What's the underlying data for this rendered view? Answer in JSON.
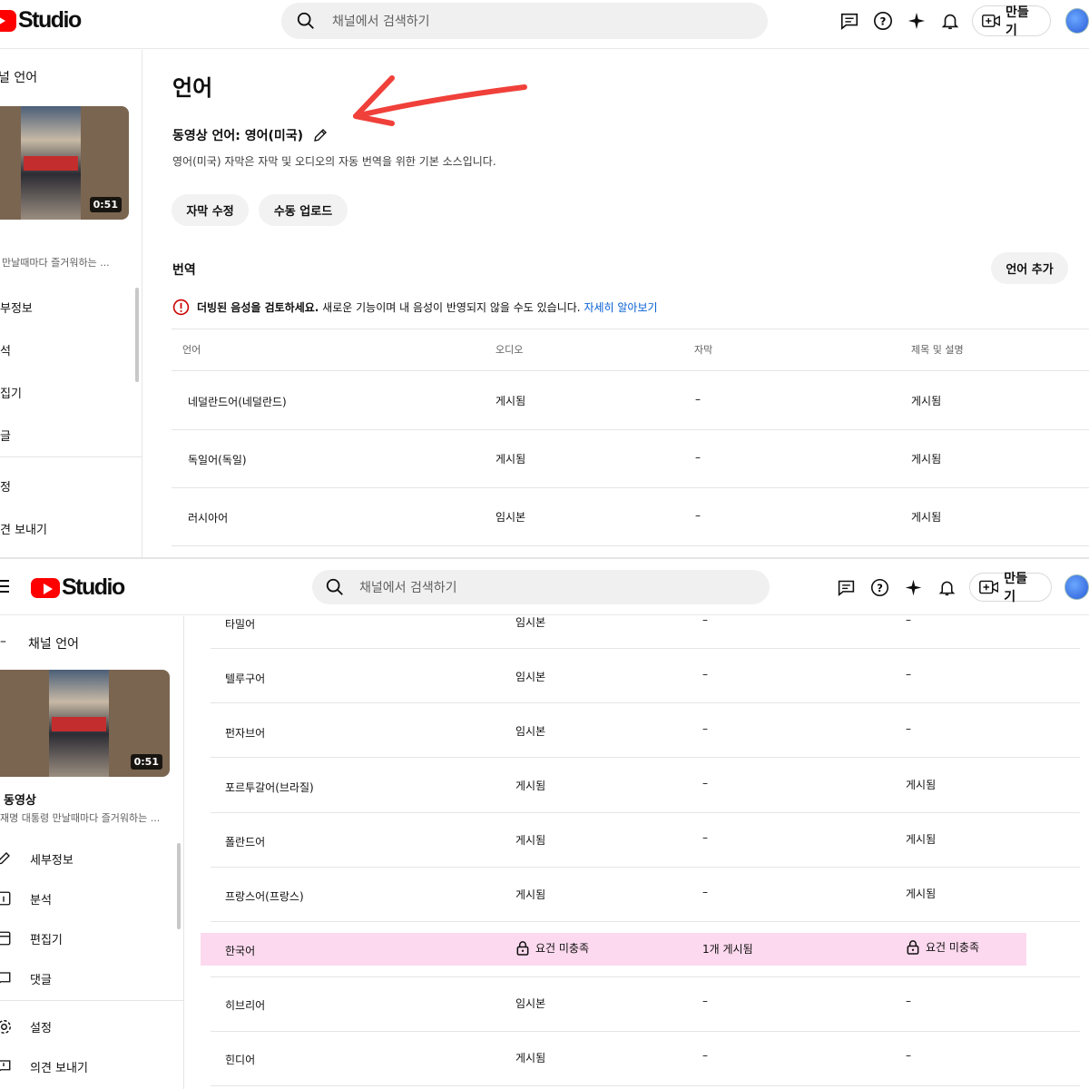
{
  "app": {
    "logo_text": "Studio",
    "search_placeholder": "채널에서 검색하기",
    "create_label": "만들기"
  },
  "screen1": {
    "sidebar": {
      "section_title": "널 언어",
      "video_duration": "0:51",
      "video_title": "만날때마다 즐거워하는 ...",
      "items": [
        "부정보",
        "석",
        "집기",
        "글",
        "정",
        "견 보내기"
      ]
    },
    "main": {
      "title": "언어",
      "video_language": "동영상 언어: 영어(미국)",
      "video_language_desc": "영어(미국) 자막은 자막 및 오디오의 자동 번역을 위한 기본 소스입니다.",
      "chips": [
        "자막 수정",
        "수동 업로드"
      ],
      "translation_label": "번역",
      "add_language": "언어 추가",
      "warning_bold": "더빙된 음성을 검토하세요.",
      "warning_text": " 새로운 기능이며 내 음성이 반영되지 않을 수도 있습니다.",
      "warning_link": "자세히 알아보기",
      "columns": [
        "언어",
        "오디오",
        "자막",
        "제목 및 설명"
      ],
      "rows": [
        {
          "lang": "네덜란드어(네덜란드)",
          "audio": "게시됨",
          "subtitle": "–",
          "title_desc": "게시됨"
        },
        {
          "lang": "독일어(독일)",
          "audio": "게시됨",
          "subtitle": "–",
          "title_desc": "게시됨"
        },
        {
          "lang": "러시아어",
          "audio": "임시본",
          "subtitle": "–",
          "title_desc": "게시됨"
        }
      ]
    }
  },
  "screen2": {
    "sidebar": {
      "section_title": "채널 언어",
      "video_duration": "0:51",
      "video_label": "동영상",
      "video_title": "재명 대통령 만날때마다 즐거워하는 ...",
      "items": [
        "세부정보",
        "분석",
        "편집기",
        "댓글",
        "설정",
        "의견 보내기"
      ]
    },
    "rows": [
      {
        "lang": "타밀어",
        "audio": "임시본",
        "subtitle": "–",
        "title_desc": "–"
      },
      {
        "lang": "텔루구어",
        "audio": "임시본",
        "subtitle": "–",
        "title_desc": "–"
      },
      {
        "lang": "펀자브어",
        "audio": "임시본",
        "subtitle": "–",
        "title_desc": "–"
      },
      {
        "lang": "포르투갈어(브라질)",
        "audio": "게시됨",
        "subtitle": "–",
        "title_desc": "게시됨"
      },
      {
        "lang": "폴란드어",
        "audio": "게시됨",
        "subtitle": "–",
        "title_desc": "게시됨"
      },
      {
        "lang": "프랑스어(프랑스)",
        "audio": "게시됨",
        "subtitle": "–",
        "title_desc": "게시됨"
      },
      {
        "lang": "한국어",
        "audio": "요건 미충족",
        "subtitle": "1개 게시됨",
        "title_desc": "요건 미충족",
        "highlighted": true
      },
      {
        "lang": "히브리어",
        "audio": "임시본",
        "subtitle": "–",
        "title_desc": "–"
      },
      {
        "lang": "힌디어",
        "audio": "게시됨",
        "subtitle": "–",
        "title_desc": "–"
      }
    ]
  },
  "colors": {
    "accent_red": "#ff0000",
    "link_blue": "#065fd4",
    "highlight_pink": "#fcd9ee",
    "arrow_red": "#f0403a"
  }
}
